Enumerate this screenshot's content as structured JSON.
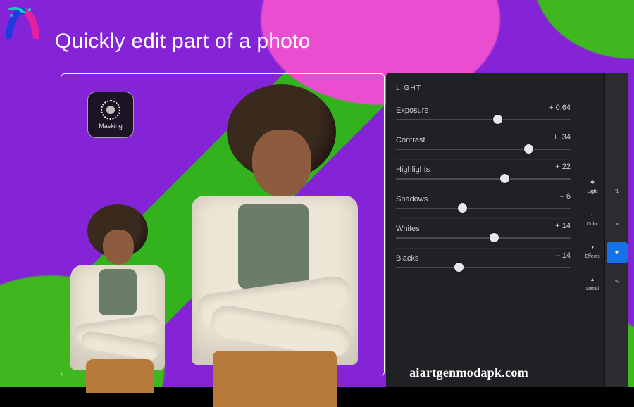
{
  "headline": "Quickly edit part of a photo",
  "watermark": "aiartgenmodapk.com",
  "masking": {
    "label": "Masking"
  },
  "panel": {
    "title": "LIGHT",
    "sliders": [
      {
        "label": "Exposure",
        "value": "+ 0.64",
        "pos": 58
      },
      {
        "label": "Contrast",
        "value": "+ .34",
        "pos": 76
      },
      {
        "label": "Highlights",
        "value": "+ 22",
        "pos": 62
      },
      {
        "label": "Shadows",
        "value": "– 6",
        "pos": 38
      },
      {
        "label": "Whites",
        "value": "+ 14",
        "pos": 56
      },
      {
        "label": "Blacks",
        "value": "– 14",
        "pos": 36
      }
    ]
  },
  "toolcol1": [
    {
      "name": "light-tool",
      "label": "Light",
      "glyph": "✲",
      "active": true
    },
    {
      "name": "color-tool",
      "label": "Color",
      "glyph": "◐",
      "active": false
    },
    {
      "name": "effects-tool",
      "label": "Effects",
      "glyph": "◑",
      "active": false
    },
    {
      "name": "detail-tool",
      "label": "Detail",
      "glyph": "▲",
      "active": false
    }
  ],
  "toolcol2": [
    {
      "name": "adjust-tool",
      "glyph": "⇅"
    },
    {
      "name": "sliders-tool",
      "glyph": "≡"
    },
    {
      "name": "gear-tool",
      "glyph": "✱",
      "blue": true
    },
    {
      "name": "brush-tool",
      "glyph": "✎"
    }
  ]
}
